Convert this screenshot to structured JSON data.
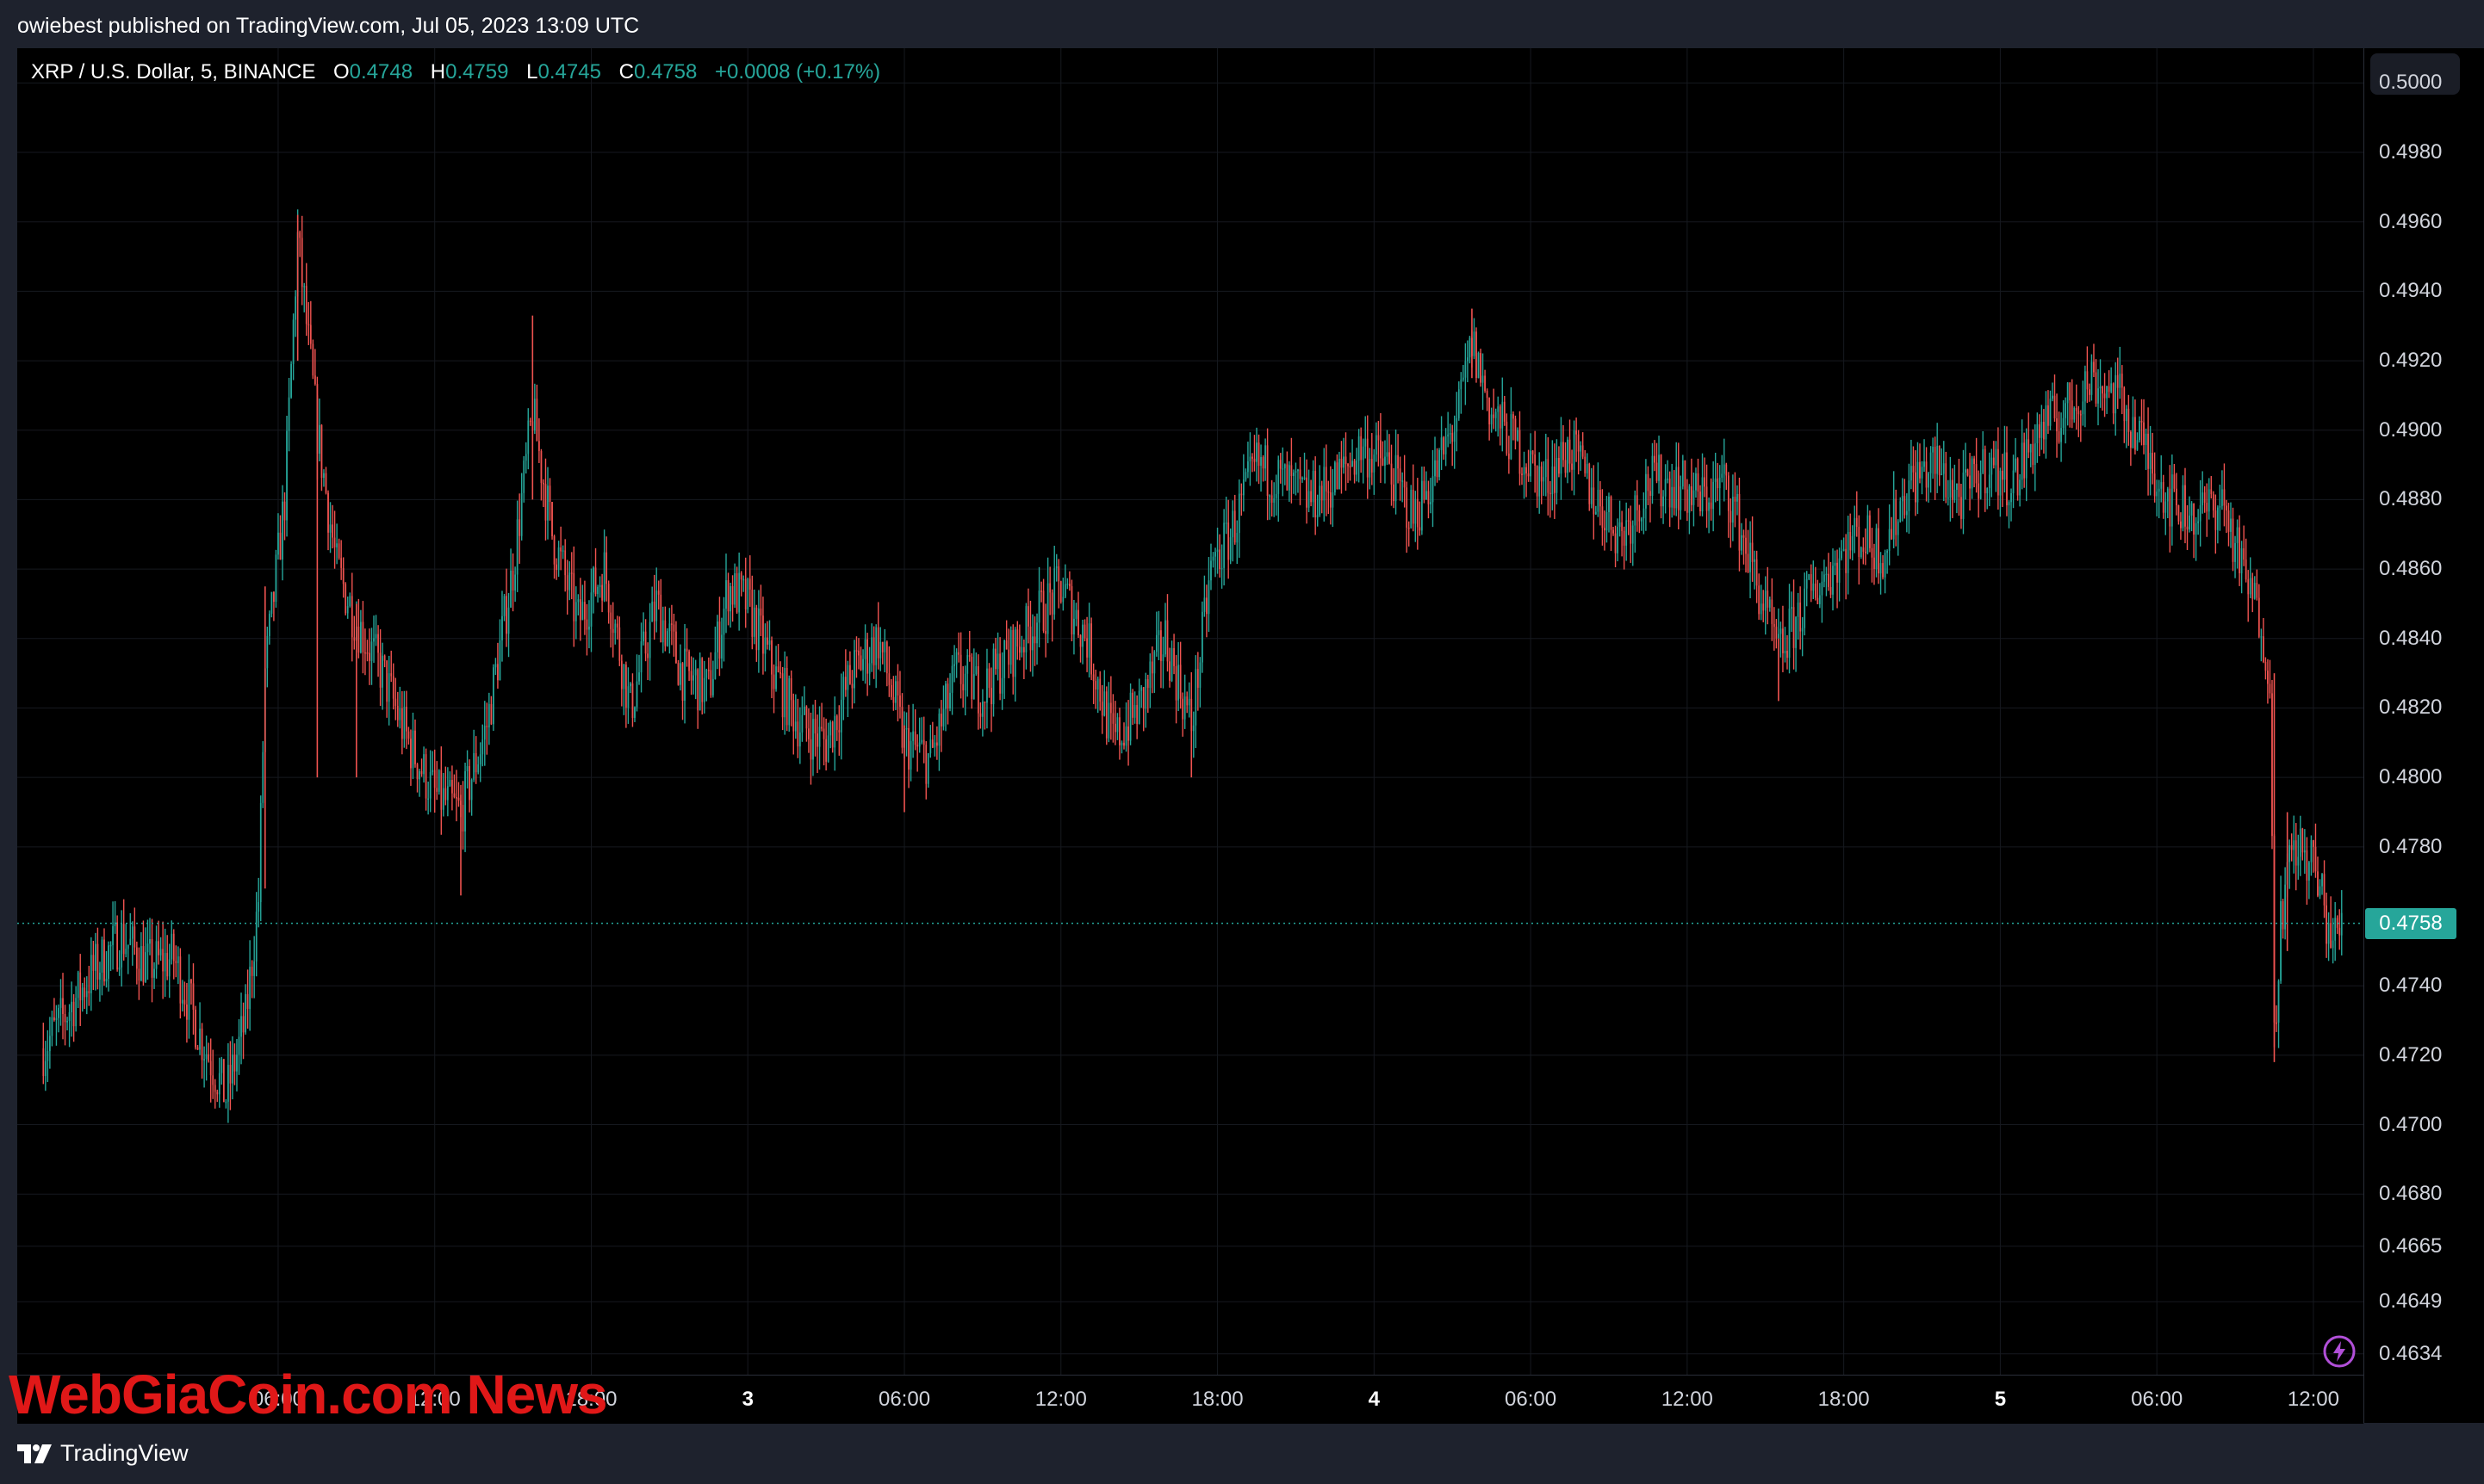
{
  "header": {
    "published_text": "owiebest published on TradingView.com, Jul 05, 2023 13:09 UTC"
  },
  "legend": {
    "symbol": "XRP / U.S. Dollar, 5, BINANCE",
    "open_label": "O",
    "open": "0.4748",
    "high_label": "H",
    "high": "0.4759",
    "low_label": "L",
    "low": "0.4745",
    "close_label": "C",
    "close": "0.4758",
    "change": "+0.0008 (+0.17%)"
  },
  "price_axis": {
    "ticks": [
      "0.5000",
      "0.4980",
      "0.4960",
      "0.4940",
      "0.4920",
      "0.4900",
      "0.4880",
      "0.4860",
      "0.4840",
      "0.4820",
      "0.4800",
      "0.4780",
      "0.4740",
      "0.4720",
      "0.4700",
      "0.4680",
      "0.4665",
      "0.4649",
      "0.4634"
    ],
    "last_price": "0.4758"
  },
  "time_axis": {
    "ticks": [
      "06:00",
      "12:00",
      "18:00",
      "3",
      "06:00",
      "12:00",
      "18:00",
      "4",
      "06:00",
      "12:00",
      "18:00",
      "5",
      "06:00",
      "12:00"
    ]
  },
  "watermark": "WebGiaCoin.com News",
  "footer": {
    "brand": "TradingView"
  },
  "colors": {
    "up": "#26a69a",
    "down": "#ef5350",
    "background": "#000000",
    "grid": "#16191f",
    "last_price_line": "#26a69a",
    "watermark": "#e01818"
  },
  "icons": {
    "indicator": "lightning-icon",
    "brand": "tradingview-logo-icon"
  },
  "chart_data": {
    "type": "candlestick",
    "title": "XRP / U.S. Dollar, 5, BINANCE",
    "interval": "5",
    "ylim": [
      0.4628,
      0.501
    ],
    "y_ticks": [
      0.5,
      0.498,
      0.496,
      0.494,
      0.492,
      0.49,
      0.488,
      0.486,
      0.484,
      0.482,
      0.48,
      0.478,
      0.474,
      0.472,
      0.47,
      0.468,
      0.4665,
      0.4649,
      0.4634
    ],
    "x_ticks": [
      {
        "label": "06:00",
        "t": "2023-07-02 06:00"
      },
      {
        "label": "12:00",
        "t": "2023-07-02 12:00"
      },
      {
        "label": "18:00",
        "t": "2023-07-02 18:00"
      },
      {
        "label": "3",
        "t": "2023-07-03 00:00"
      },
      {
        "label": "06:00",
        "t": "2023-07-03 06:00"
      },
      {
        "label": "12:00",
        "t": "2023-07-03 12:00"
      },
      {
        "label": "18:00",
        "t": "2023-07-03 18:00"
      },
      {
        "label": "4",
        "t": "2023-07-04 00:00"
      },
      {
        "label": "06:00",
        "t": "2023-07-04 06:00"
      },
      {
        "label": "12:00",
        "t": "2023-07-04 12:00"
      },
      {
        "label": "18:00",
        "t": "2023-07-04 18:00"
      },
      {
        "label": "5",
        "t": "2023-07-05 00:00"
      },
      {
        "label": "06:00",
        "t": "2023-07-05 06:00"
      },
      {
        "label": "12:00",
        "t": "2023-07-05 12:00"
      }
    ],
    "last_price": 0.4758,
    "grid": true,
    "path": [
      [
        "2023-07-01 21:00",
        0.4722
      ],
      [
        "2023-07-01 23:00",
        0.4745
      ],
      [
        "2023-07-02 00:00",
        0.4754
      ],
      [
        "2023-07-02 01:00",
        0.4746
      ],
      [
        "2023-07-02 02:00",
        0.4748
      ],
      [
        "2023-07-02 03:00",
        0.4726
      ],
      [
        "2023-07-02 04:00",
        0.4708
      ],
      [
        "2023-07-02 04:45",
        0.473
      ],
      [
        "2023-07-02 05:15",
        0.4765
      ],
      [
        "2023-07-02 05:30",
        0.483
      ],
      [
        "2023-07-02 06:15",
        0.488
      ],
      [
        "2023-07-02 06:45",
        0.4955
      ],
      [
        "2023-07-02 07:30",
        0.49
      ],
      [
        "2023-07-02 08:15",
        0.486
      ],
      [
        "2023-07-02 09:00",
        0.4845
      ],
      [
        "2023-07-02 10:00",
        0.483
      ],
      [
        "2023-07-02 11:00",
        0.481
      ],
      [
        "2023-07-02 12:00",
        0.4795
      ],
      [
        "2023-07-02 13:00",
        0.479
      ],
      [
        "2023-07-02 14:00",
        0.4815
      ],
      [
        "2023-07-02 15:00",
        0.486
      ],
      [
        "2023-07-02 15:45",
        0.4905
      ],
      [
        "2023-07-02 16:30",
        0.487
      ],
      [
        "2023-07-02 17:30",
        0.4845
      ],
      [
        "2023-07-02 18:30",
        0.486
      ],
      [
        "2023-07-02 19:30",
        0.482
      ],
      [
        "2023-07-02 20:30",
        0.485
      ],
      [
        "2023-07-02 21:30",
        0.483
      ],
      [
        "2023-07-02 22:30",
        0.4825
      ],
      [
        "2023-07-02 23:15",
        0.4855
      ],
      [
        "2023-07-03 00:00",
        0.485
      ],
      [
        "2023-07-03 01:00",
        0.483
      ],
      [
        "2023-07-03 02:00",
        0.4815
      ],
      [
        "2023-07-03 03:00",
        0.481
      ],
      [
        "2023-07-03 04:00",
        0.483
      ],
      [
        "2023-07-03 05:00",
        0.484
      ],
      [
        "2023-07-03 06:00",
        0.481
      ],
      [
        "2023-07-03 07:00",
        0.4805
      ],
      [
        "2023-07-03 08:00",
        0.483
      ],
      [
        "2023-07-03 09:00",
        0.4825
      ],
      [
        "2023-07-03 10:00",
        0.4835
      ],
      [
        "2023-07-03 11:00",
        0.4845
      ],
      [
        "2023-07-03 12:00",
        0.4855
      ],
      [
        "2023-07-03 13:00",
        0.484
      ],
      [
        "2023-07-03 14:00",
        0.481
      ],
      [
        "2023-07-03 15:00",
        0.482
      ],
      [
        "2023-07-03 16:00",
        0.484
      ],
      [
        "2023-07-03 17:00",
        0.4815
      ],
      [
        "2023-07-03 17:45",
        0.486
      ],
      [
        "2023-07-03 18:30",
        0.487
      ],
      [
        "2023-07-03 19:30",
        0.489
      ],
      [
        "2023-07-03 20:30",
        0.4885
      ],
      [
        "2023-07-03 21:30",
        0.488
      ],
      [
        "2023-07-03 22:30",
        0.4885
      ],
      [
        "2023-07-03 23:30",
        0.4895
      ],
      [
        "2023-07-04 00:30",
        0.489
      ],
      [
        "2023-07-04 01:30",
        0.4875
      ],
      [
        "2023-07-04 02:30",
        0.489
      ],
      [
        "2023-07-04 03:15",
        0.4905
      ],
      [
        "2023-07-04 03:45",
        0.4925
      ],
      [
        "2023-07-04 04:30",
        0.4905
      ],
      [
        "2023-07-04 05:30",
        0.4895
      ],
      [
        "2023-07-04 06:30",
        0.4885
      ],
      [
        "2023-07-04 07:30",
        0.4895
      ],
      [
        "2023-07-04 08:30",
        0.488
      ],
      [
        "2023-07-04 09:30",
        0.487
      ],
      [
        "2023-07-04 10:30",
        0.4885
      ],
      [
        "2023-07-04 11:30",
        0.4885
      ],
      [
        "2023-07-04 12:30",
        0.488
      ],
      [
        "2023-07-04 13:30",
        0.4885
      ],
      [
        "2023-07-04 14:30",
        0.486
      ],
      [
        "2023-07-04 15:30",
        0.4835
      ],
      [
        "2023-07-04 16:30",
        0.485
      ],
      [
        "2023-07-04 17:30",
        0.486
      ],
      [
        "2023-07-04 18:30",
        0.487
      ],
      [
        "2023-07-04 19:30",
        0.4865
      ],
      [
        "2023-07-04 20:30",
        0.4885
      ],
      [
        "2023-07-04 21:30",
        0.489
      ],
      [
        "2023-07-04 22:30",
        0.488
      ],
      [
        "2023-07-04 23:30",
        0.489
      ],
      [
        "2023-07-05 00:30",
        0.4885
      ],
      [
        "2023-07-05 01:30",
        0.49
      ],
      [
        "2023-07-05 02:30",
        0.4905
      ],
      [
        "2023-07-05 03:30",
        0.4915
      ],
      [
        "2023-07-05 04:30",
        0.491
      ],
      [
        "2023-07-05 05:30",
        0.4895
      ],
      [
        "2023-07-05 06:30",
        0.488
      ],
      [
        "2023-07-05 07:30",
        0.4875
      ],
      [
        "2023-07-05 08:30",
        0.488
      ],
      [
        "2023-07-05 09:15",
        0.486
      ],
      [
        "2023-07-05 10:00",
        0.4845
      ],
      [
        "2023-07-05 10:20",
        0.483
      ],
      [
        "2023-07-05 10:30",
        0.4725
      ],
      [
        "2023-07-05 10:45",
        0.476
      ],
      [
        "2023-07-05 11:15",
        0.478
      ],
      [
        "2023-07-05 12:00",
        0.4775
      ],
      [
        "2023-07-05 12:45",
        0.4752
      ],
      [
        "2023-07-05 13:05",
        0.4758
      ]
    ],
    "spikes": [
      {
        "t": "2023-07-02 05:30",
        "high": 0.4855,
        "low": 0.4768
      },
      {
        "t": "2023-07-02 06:45",
        "high": 0.4962,
        "low": 0.492
      },
      {
        "t": "2023-07-02 07:30",
        "high": 0.491,
        "low": 0.48
      },
      {
        "t": "2023-07-02 09:00",
        "high": 0.485,
        "low": 0.48
      },
      {
        "t": "2023-07-02 13:00",
        "high": 0.4795,
        "low": 0.4766
      },
      {
        "t": "2023-07-02 15:45",
        "high": 0.4933,
        "low": 0.488
      },
      {
        "t": "2023-07-03 06:00",
        "high": 0.4815,
        "low": 0.479
      },
      {
        "t": "2023-07-03 17:00",
        "high": 0.482,
        "low": 0.48
      },
      {
        "t": "2023-07-04 03:45",
        "high": 0.4935,
        "low": 0.4915
      },
      {
        "t": "2023-07-04 15:30",
        "high": 0.484,
        "low": 0.4822
      },
      {
        "t": "2023-07-05 10:30",
        "high": 0.483,
        "low": 0.4718
      },
      {
        "t": "2023-07-05 11:00",
        "high": 0.479,
        "low": 0.475
      }
    ]
  }
}
